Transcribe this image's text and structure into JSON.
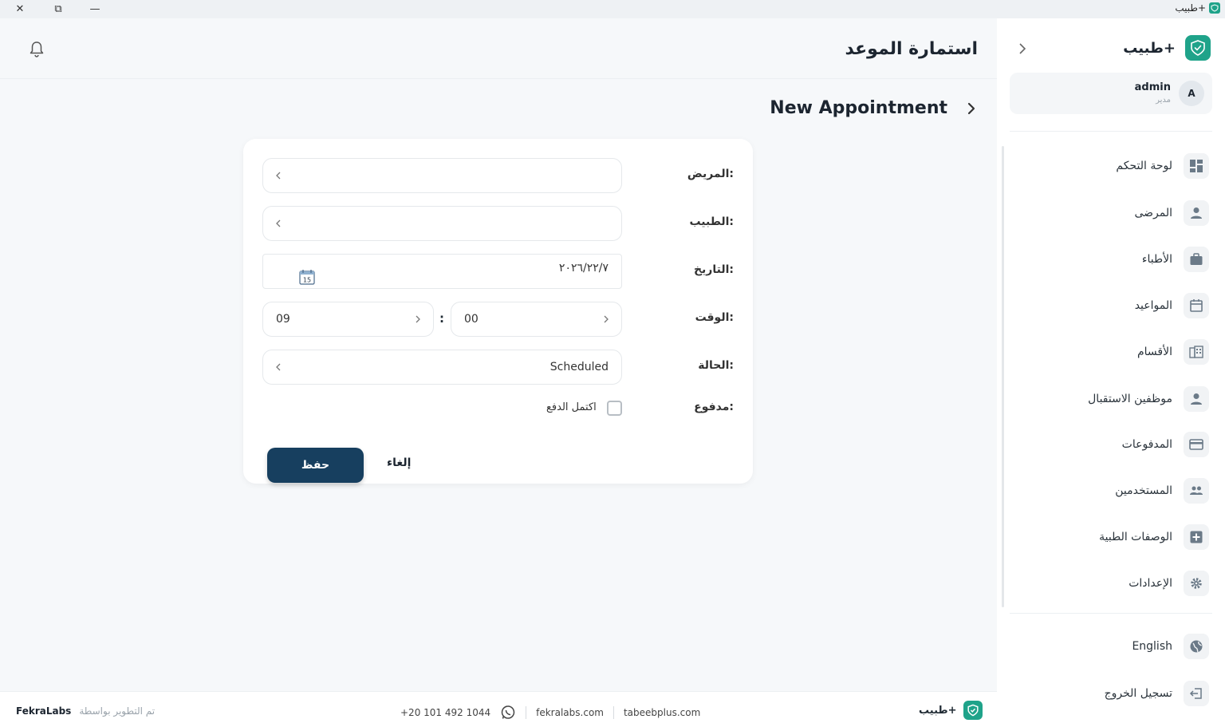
{
  "titlebar": {
    "app_title": "طبيب+",
    "close": "✕",
    "restore": "⧉",
    "minimize": "—"
  },
  "header": {
    "title": "استمارة الموعد"
  },
  "subheader": {
    "title": "New Appointment"
  },
  "form": {
    "patient_label": "المريض:",
    "patient_value": "",
    "doctor_label": "الطبيب:",
    "doctor_value": "",
    "date_label": "التاريخ:",
    "date_value": "٢٠٢٦/٢٢/٧",
    "calendar_day": "15",
    "time_label": "الوقت:",
    "time_minutes": "00",
    "time_hours": "09",
    "time_separator": ":",
    "status_label": "الحالة:",
    "status_value": "Scheduled",
    "paid_label": "مدفوع:",
    "paid_checkbox_label": "اكتمل الدفع",
    "paid_checked": false,
    "save_label": "حفظ",
    "cancel_label": "إلغاء"
  },
  "sidebar": {
    "brand": "طبيب+",
    "user": {
      "name": "admin",
      "role": "مدير",
      "initial": "A"
    },
    "items": [
      {
        "label": "لوحة التحكم",
        "icon": "dashboard-icon"
      },
      {
        "label": "المرضى",
        "icon": "person-icon"
      },
      {
        "label": "الأطباء",
        "icon": "briefcase-icon"
      },
      {
        "label": "المواعيد",
        "icon": "calendar-icon"
      },
      {
        "label": "الأقسام",
        "icon": "building-icon"
      },
      {
        "label": "موظفين الاستقبال",
        "icon": "person-icon"
      },
      {
        "label": "المدفوعات",
        "icon": "credit-card-icon"
      },
      {
        "label": "المستخدمين",
        "icon": "group-icon"
      },
      {
        "label": "الوصفات الطبية",
        "icon": "medical-plus-icon"
      },
      {
        "label": "الإعدادات",
        "icon": "gear-icon"
      }
    ],
    "language": "English",
    "logout": "تسجيل الخروج"
  },
  "footer": {
    "developed_by": "تم التطوير بواسطة",
    "company": "FekraLabs",
    "phone": "+20 101 492 1044",
    "site1": "fekralabs.com",
    "site2": "tabeebplus.com",
    "brand": "طبيب+"
  },
  "colors": {
    "primary": "#173f5f",
    "brand": "#1fa38a",
    "background": "#f6f8fa"
  }
}
